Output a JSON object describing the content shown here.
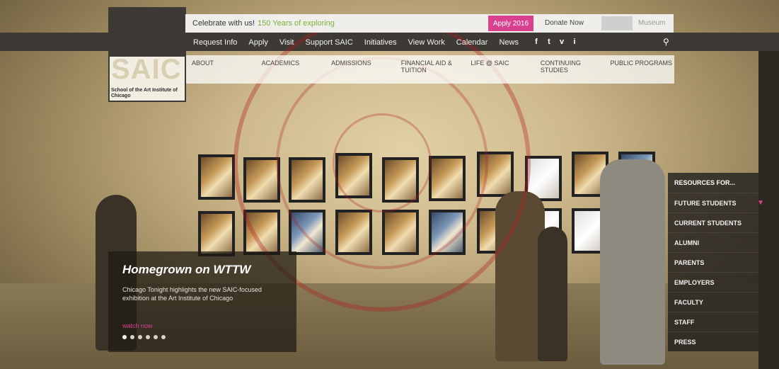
{
  "utility": {
    "celebrate_prefix": "Celebrate with us!",
    "celebrate_highlight": "150 Years of exploring",
    "apply_button": "Apply 2016",
    "donate": "Donate Now",
    "museum": "Museum"
  },
  "logo": {
    "mark": "SAIC",
    "subtitle": "School of the Art Institute of Chicago"
  },
  "mainnav": {
    "items": [
      "Request Info",
      "Apply",
      "Visit",
      "Support SAIC",
      "Initiatives",
      "View Work",
      "Calendar",
      "News"
    ],
    "social": [
      "f",
      "t",
      "v",
      "i"
    ],
    "search_icon": "search-icon"
  },
  "subnav": {
    "items": [
      "About",
      "Academics",
      "Admissions",
      "Financial Aid & Tuition",
      "Life @ SAIC",
      "Continuing Studies",
      "Public Programs"
    ]
  },
  "feature": {
    "title": "Homegrown on WTTW",
    "description": "Chicago Tonight highlights the new SAIC-focused exhibition at the Art Institute of Chicago",
    "link": "watch now",
    "dots_count": 6,
    "active_dot": 0
  },
  "resources": {
    "header": "Resources for...",
    "items": [
      "Future Students",
      "Current Students",
      "Alumni",
      "Parents",
      "Employers",
      "Faculty",
      "Staff",
      "Press"
    ]
  },
  "colors": {
    "accent": "#d9418f",
    "nav_bg": "#3d3a35",
    "highlight_green": "#7db03a"
  }
}
